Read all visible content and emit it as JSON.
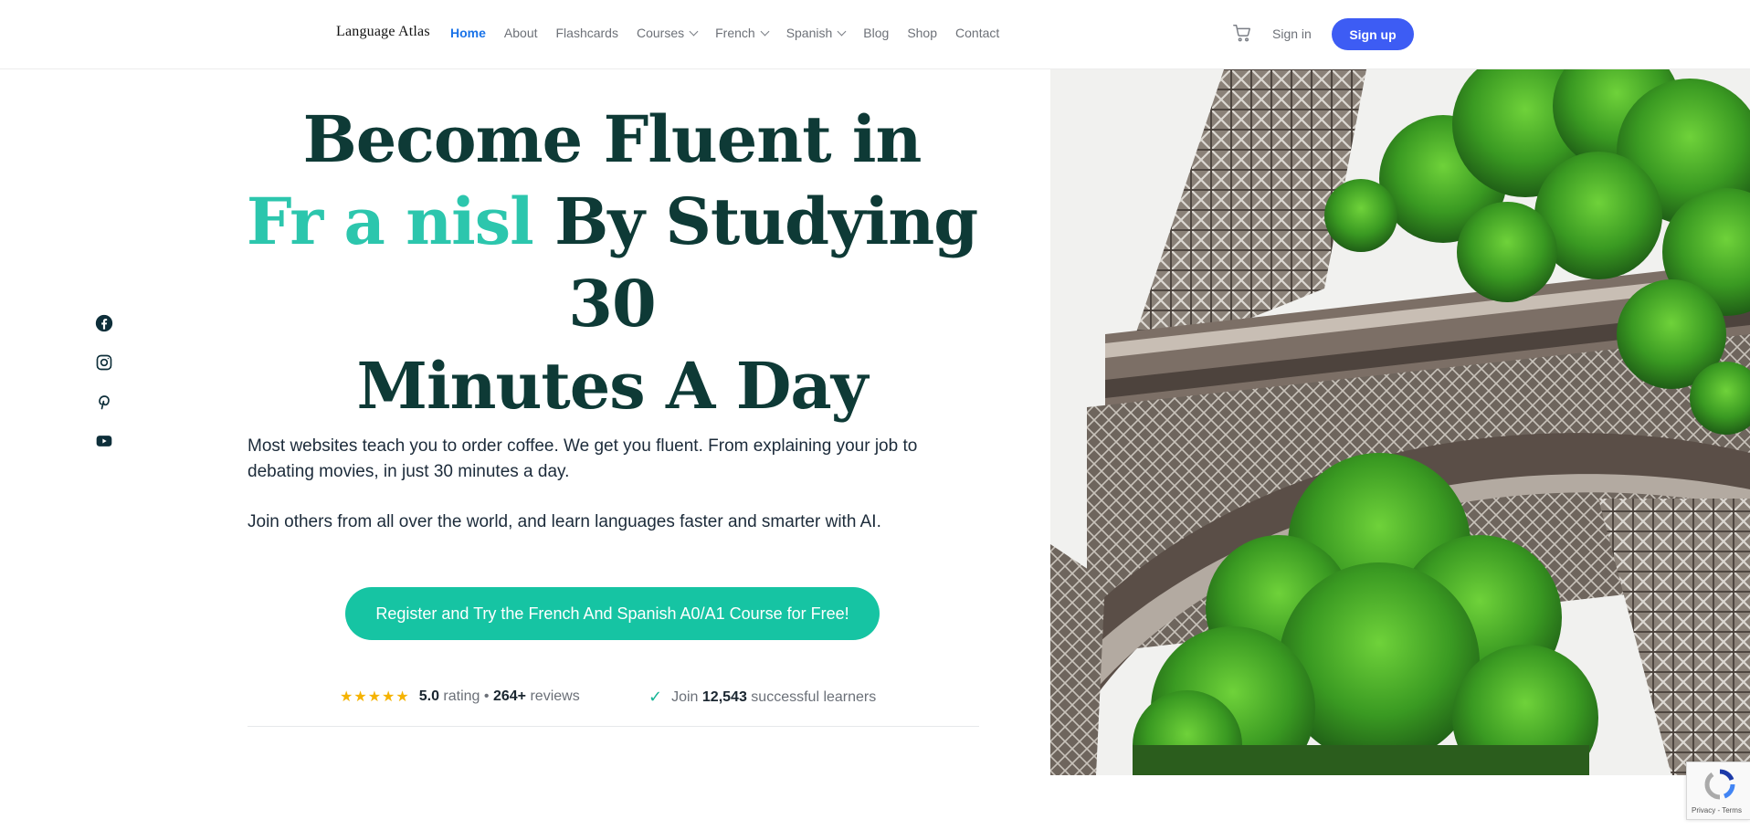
{
  "header": {
    "logo": "Language Atlas",
    "nav": [
      {
        "label": "Home",
        "active": true,
        "dropdown": false
      },
      {
        "label": "About",
        "active": false,
        "dropdown": false
      },
      {
        "label": "Flashcards",
        "active": false,
        "dropdown": false
      },
      {
        "label": "Courses",
        "active": false,
        "dropdown": true
      },
      {
        "label": "French",
        "active": false,
        "dropdown": true
      },
      {
        "label": "Spanish",
        "active": false,
        "dropdown": true
      },
      {
        "label": "Blog",
        "active": false,
        "dropdown": false
      },
      {
        "label": "Shop",
        "active": false,
        "dropdown": false
      },
      {
        "label": "Contact",
        "active": false,
        "dropdown": false
      }
    ],
    "cart_icon": "cart-icon",
    "signin_label": "Sign in",
    "signup_label": "Sign up"
  },
  "social": [
    "facebook-icon",
    "instagram-icon",
    "pinterest-icon",
    "youtube-icon"
  ],
  "hero": {
    "headline_line1": "Become Fluent in",
    "headline_rotating": "Fr a nisl",
    "headline_line2_rest": " By Studying 30",
    "headline_line3": "Minutes A Day",
    "paragraph1": "Most websites teach you to order coffee. We get you fluent. From explaining your job to debating movies, in just 30 minutes a day.",
    "paragraph2": "Join others from all over the world, and learn languages faster and smarter with AI.",
    "cta_label": "Register and Try the French And Spanish A0/A1 Course for Free!",
    "rating": {
      "stars": "★★★★★",
      "score": "5.0",
      "rating_word": "rating",
      "separator": "•",
      "reviews_count": "264+",
      "reviews_word": "reviews"
    },
    "learners": {
      "check": "✓",
      "join_word": "Join",
      "count": "12,543",
      "suffix": "successful learners"
    }
  },
  "recaptcha": {
    "text": "Privacy - Terms"
  },
  "colors": {
    "accent_teal": "#16c4a3",
    "headline_dark": "#0e3a36",
    "signup_blue": "#3d5cf4",
    "nav_active": "#1a73e8",
    "star_gold": "#f5b301"
  }
}
